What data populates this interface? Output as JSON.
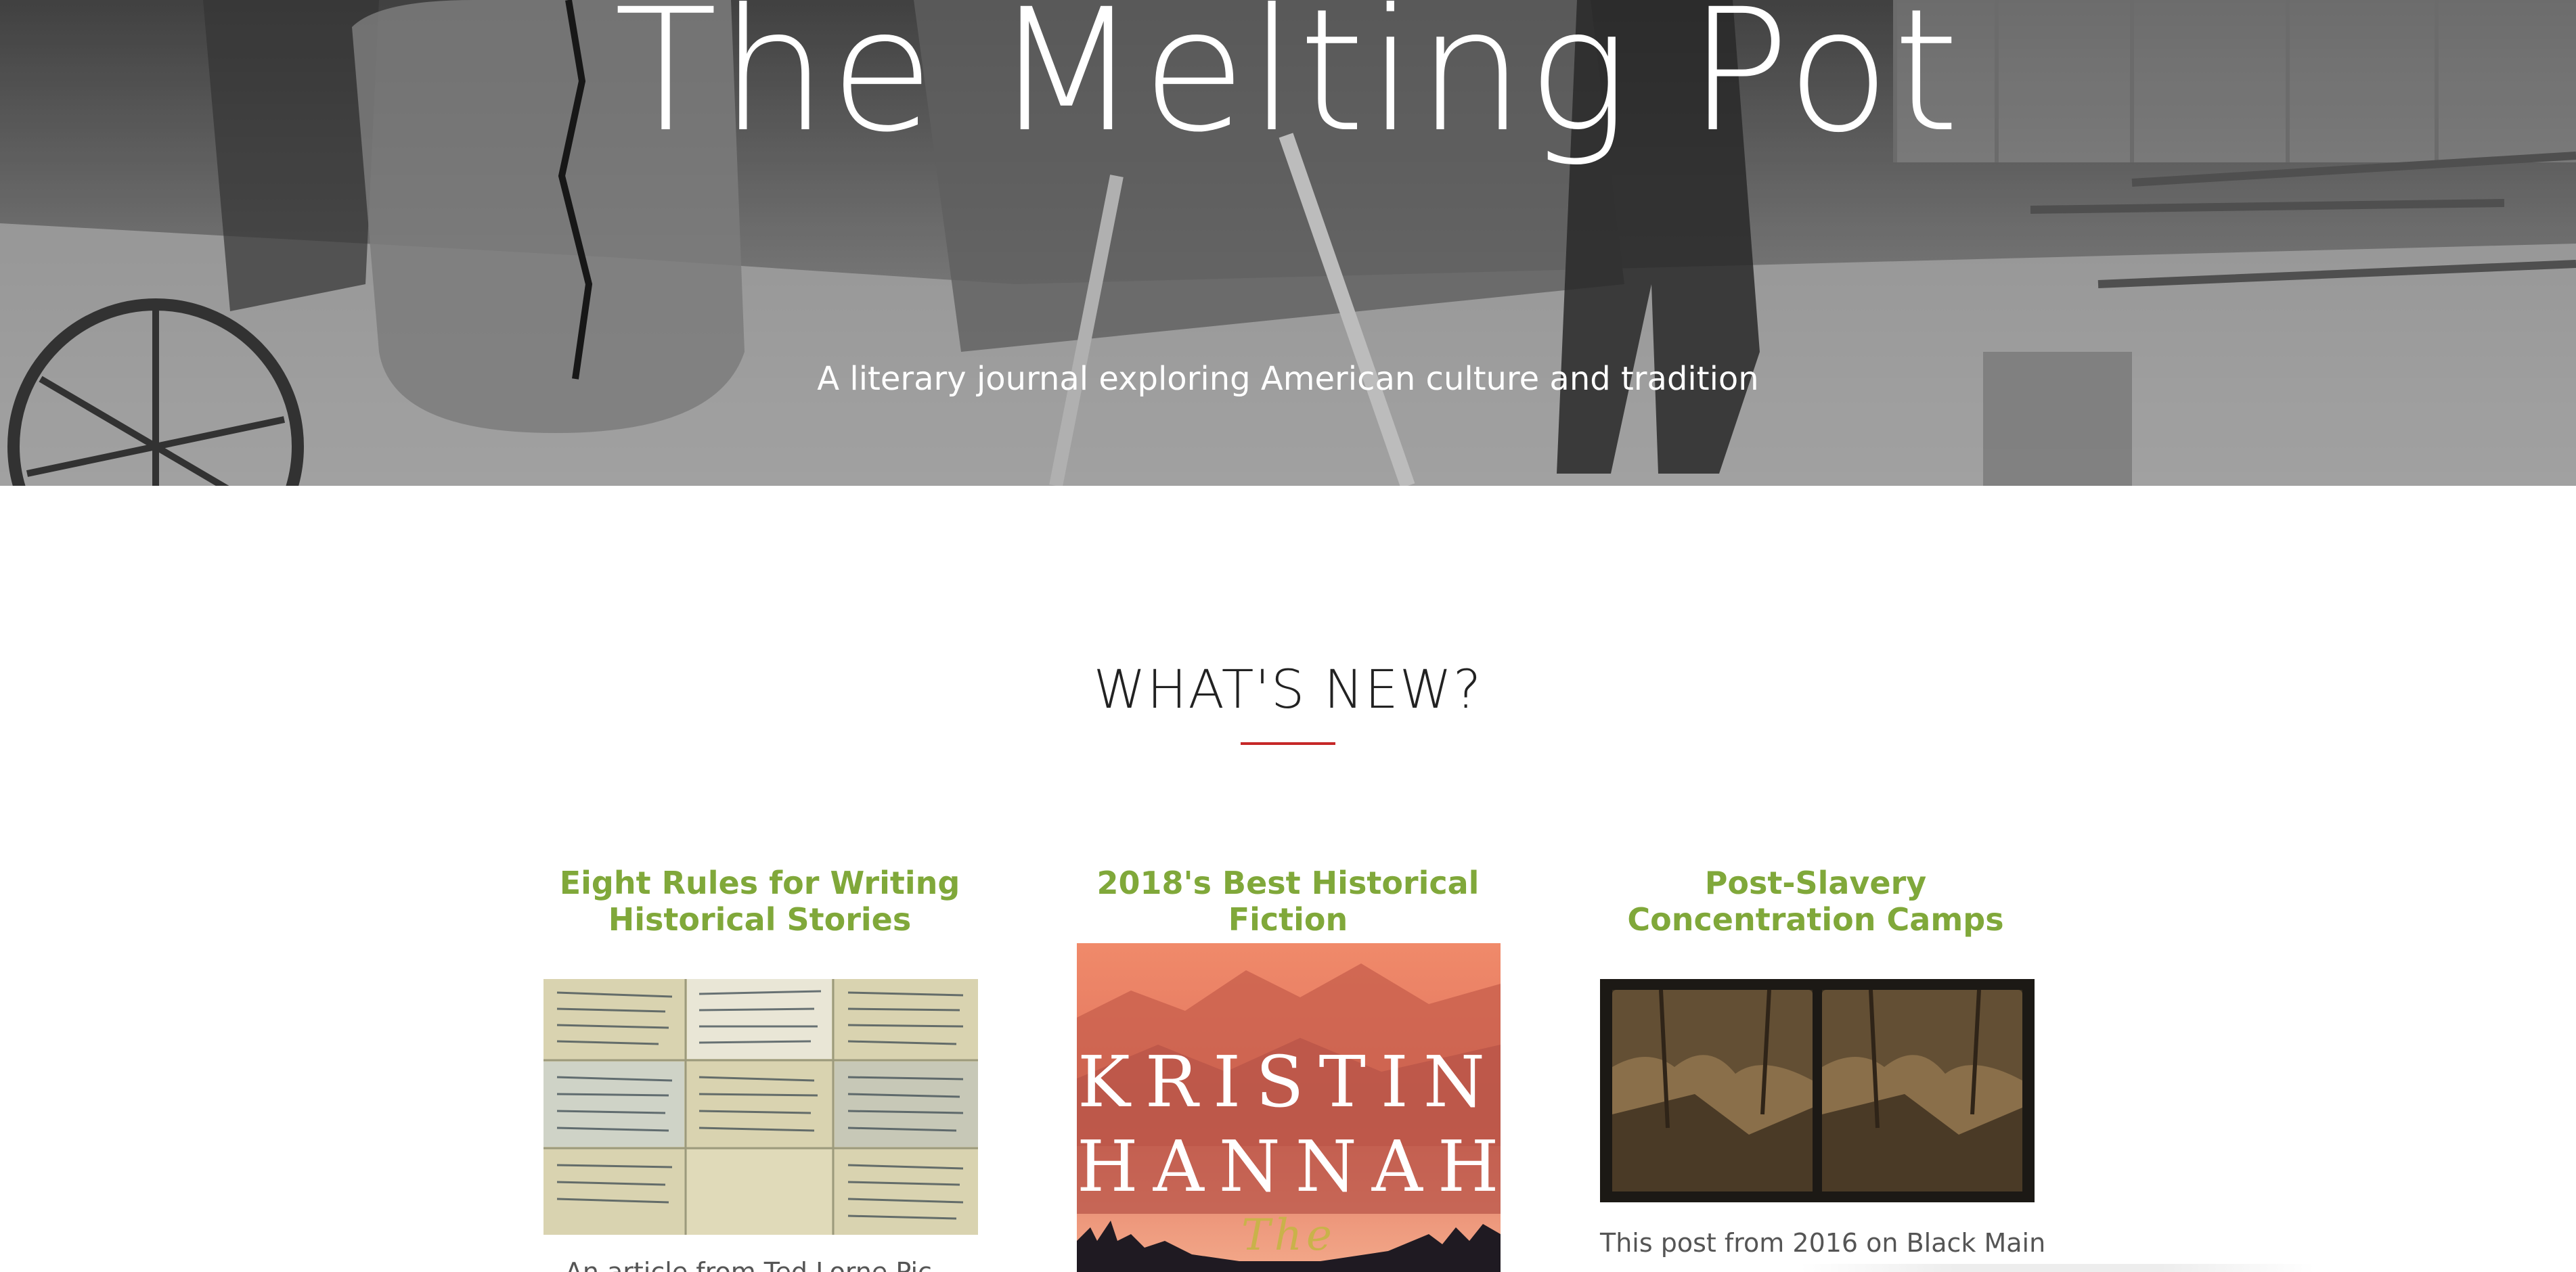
{
  "hero": {
    "title": "The Melting Pot",
    "tagline": "A literary journal exploring American culture and tradition"
  },
  "section": {
    "heading": "WHAT'S NEW?"
  },
  "cards": [
    {
      "title": "Eight Rules for Writing Historical Stories",
      "excerpt": "An article from Ted Lorne Pic..."
    },
    {
      "title": "2018's Best Historical Fiction",
      "cover_author_line1": "KRISTIN",
      "cover_author_line2": "HANNAH",
      "cover_subtitle": "The"
    },
    {
      "title": "Post-Slavery Concentration Camps",
      "excerpt": "This post from 2016 on Black Main"
    }
  ],
  "colors": {
    "accent_green": "#80a83a",
    "underline_red": "#c62828"
  }
}
